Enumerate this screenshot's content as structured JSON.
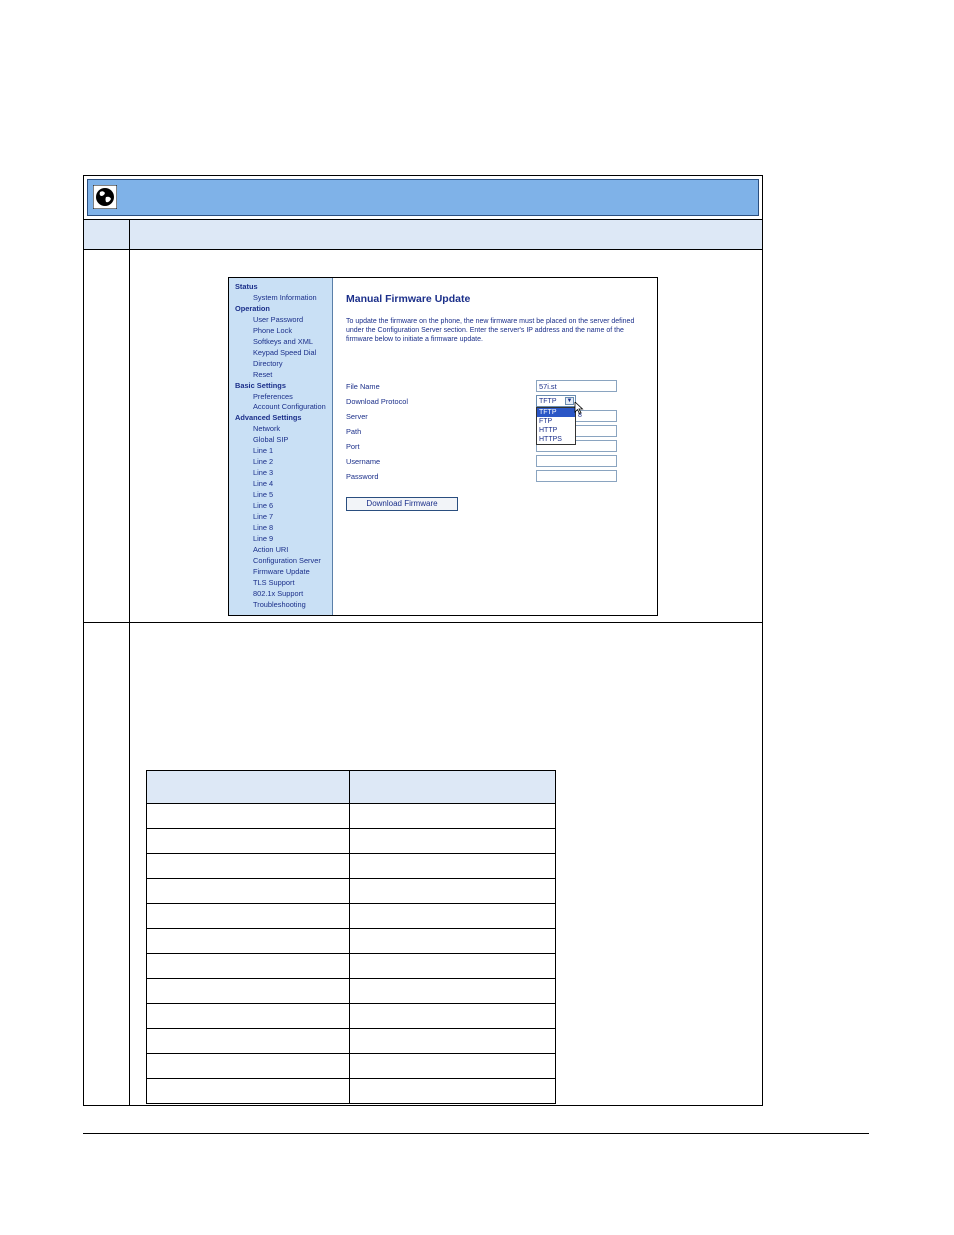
{
  "colors": {
    "banner": "#7fb2e8",
    "header_row": "#dde8f6",
    "nav_bg": "#c9e0f5",
    "link_text": "#1b2f8a",
    "dropdown_selected": "#2a56c6"
  },
  "icons": {
    "banner_icon": "globe-icon",
    "cursor": "mouse-pointer-icon"
  },
  "webui": {
    "nav": [
      {
        "label": "Status",
        "type": "section"
      },
      {
        "label": "System Information",
        "type": "item"
      },
      {
        "label": "Operation",
        "type": "section"
      },
      {
        "label": "User Password",
        "type": "item"
      },
      {
        "label": "Phone Lock",
        "type": "item"
      },
      {
        "label": "Softkeys and XML",
        "type": "item"
      },
      {
        "label": "Keypad Speed Dial",
        "type": "item"
      },
      {
        "label": "Directory",
        "type": "item"
      },
      {
        "label": "Reset",
        "type": "item"
      },
      {
        "label": "Basic Settings",
        "type": "section"
      },
      {
        "label": "Preferences",
        "type": "item"
      },
      {
        "label": "Account Configuration",
        "type": "item"
      },
      {
        "label": "Advanced Settings",
        "type": "section"
      },
      {
        "label": "Network",
        "type": "item"
      },
      {
        "label": "Global SIP",
        "type": "item"
      },
      {
        "label": "Line 1",
        "type": "item"
      },
      {
        "label": "Line 2",
        "type": "item"
      },
      {
        "label": "Line 3",
        "type": "item"
      },
      {
        "label": "Line 4",
        "type": "item"
      },
      {
        "label": "Line 5",
        "type": "item"
      },
      {
        "label": "Line 6",
        "type": "item"
      },
      {
        "label": "Line 7",
        "type": "item"
      },
      {
        "label": "Line 8",
        "type": "item"
      },
      {
        "label": "Line 9",
        "type": "item"
      },
      {
        "label": "Action URI",
        "type": "item"
      },
      {
        "label": "Configuration Server",
        "type": "item"
      },
      {
        "label": "Firmware Update",
        "type": "item"
      },
      {
        "label": "TLS Support",
        "type": "item"
      },
      {
        "label": "802.1x Support",
        "type": "item"
      },
      {
        "label": "Troubleshooting",
        "type": "item"
      }
    ],
    "title": "Manual Firmware Update",
    "description": "To update the firmware on the phone, the new firmware must be placed on the server defined under the Configuration Server section. Enter the server's IP address and the name of the firmware below to initiate a firmware update.",
    "fields": {
      "file_name_label": "File Name",
      "file_name_value": "57i.st",
      "protocol_label": "Download Protocol",
      "protocol_value": "TFTP",
      "protocol_options": [
        "TFTP",
        "FTP",
        "HTTP",
        "HTTPS"
      ],
      "server_label": "Server",
      "server_partial": "8",
      "path_label": "Path",
      "port_label": "Port",
      "username_label": "Username",
      "password_label": "Password"
    },
    "button_label": "Download Firmware"
  }
}
